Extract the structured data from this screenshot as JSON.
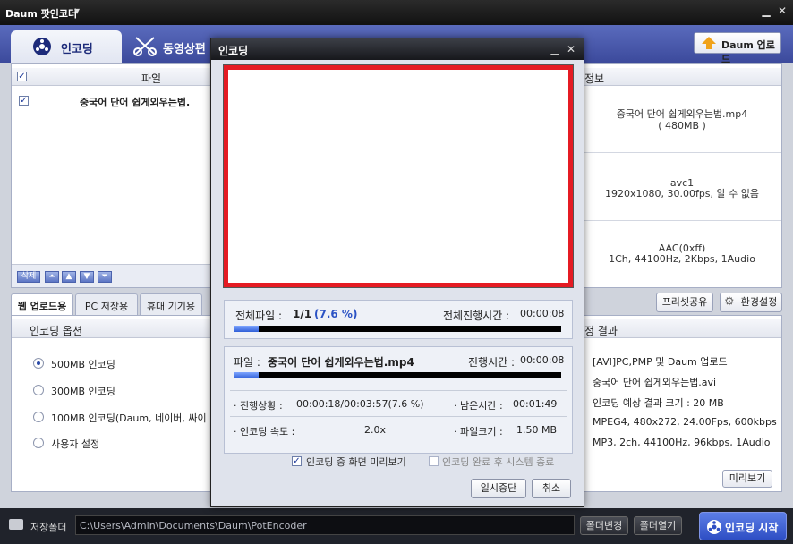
{
  "app": {
    "title": "Daum 팟인코더"
  },
  "header": {
    "tab_encode": "인코딩",
    "tab_video": "동영상편",
    "upload_label": "Daum 업로드"
  },
  "filelist": {
    "column_label": "파일",
    "file_name": "중국어 단어 쉽게외우는법.",
    "delete_label": "삭제",
    "checked": true
  },
  "info": {
    "header": "정보",
    "file_line1": "중국어 단어 쉽게외우는법.mp4",
    "file_line2": "( 480MB )",
    "video_line1": "avc1",
    "video_line2": "1920x1080, 30.00fps, 알 수 없음",
    "audio_line1": "AAC(0xff)",
    "audio_line2": "1Ch, 44100Hz, 2Kbps, 1Audio"
  },
  "preset_tabs": [
    "웹 업로드용",
    "PC 저장용",
    "휴대 기기용"
  ],
  "buttons": {
    "share": "프리셋공유",
    "settings": "환경설정",
    "preview": "미리보기"
  },
  "options": {
    "header": "인코딩 옵션",
    "items": [
      {
        "label": "500MB 인코딩",
        "selected": true
      },
      {
        "label": "300MB 인코딩",
        "selected": false
      },
      {
        "label": "100MB 인코딩(Daum, 네이버, 싸이",
        "selected": false
      },
      {
        "label": "사용자 설정",
        "selected": false
      }
    ]
  },
  "result": {
    "header": "정 결과",
    "lines": [
      "[AVI]PC,PMP 및 Daum 업로드",
      "중국어 단어 쉽게외우는법.avi",
      "인코딩 예상 결과 크기 : 20 MB",
      "MPEG4, 480x272, 24.00Fps, 600kbps",
      "MP3, 2ch, 44100Hz, 96kbps, 1Audio"
    ]
  },
  "bottom": {
    "folder_label": "저장폴더",
    "folder_path": "C:\\Users\\Admin\\Documents\\Daum\\PotEncoder",
    "change_label": "폴더변경",
    "open_label": "폴더열기",
    "start_label": "인코딩 시작"
  },
  "dialog": {
    "title": "인코딩",
    "total_label": "전체파일 :",
    "total_value": "1/1",
    "total_percent": "(7.6 %)",
    "total_time_label": "전체진행시간 :",
    "total_time": "00:00:08",
    "total_progress": 0.076,
    "file_label": "파일 :",
    "file_value": "중국어 단어 쉽게외우는법.mp4",
    "file_time_label": "진행시간 :",
    "file_time": "00:00:08",
    "file_progress": 0.076,
    "status_label": "· 진행상황 :",
    "status_value": "00:00:18/00:03:57(7.6 %)",
    "remain_label": "· 남은시간 :",
    "remain_value": "00:01:49",
    "speed_label": "· 인코딩 속도 :",
    "speed_value": "2.0x",
    "size_label": "· 파일크기 :",
    "size_value": "1.50 MB",
    "preview_check_label": "인코딩 중 화면 미리보기",
    "preview_checked": true,
    "shutdown_check_label": "인코딩 완료 후 시스템 종료",
    "shutdown_checked": false,
    "pause_label": "일시중단",
    "cancel_label": "취소"
  }
}
